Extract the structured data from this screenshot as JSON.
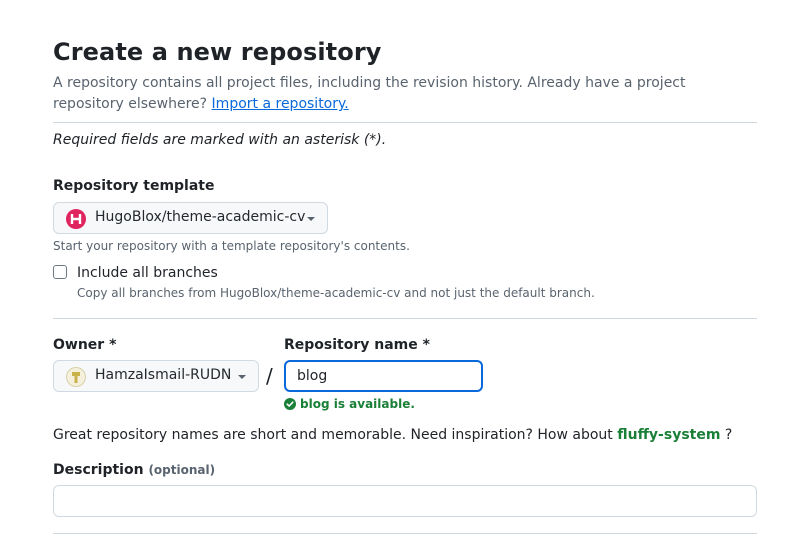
{
  "header": {
    "title": "Create a new repository",
    "description": "A repository contains all project files, including the revision history. Already have a project repository elsewhere?",
    "import_link": "Import a repository."
  },
  "required_note": "Required fields are marked with an asterisk (*).",
  "template": {
    "label": "Repository template",
    "selected": "HugoBlox/theme-academic-cv",
    "hint": "Start your repository with a template repository's contents."
  },
  "include_branches": {
    "label": "Include all branches",
    "hint": "Copy all branches from HugoBlox/theme-academic-cv and not just the default branch.",
    "checked": false
  },
  "owner": {
    "label": "Owner *",
    "selected": "HamzaIsmail-RUDN"
  },
  "separator": "/",
  "repo_name": {
    "label": "Repository name *",
    "value": "blog",
    "availability": "blog is available."
  },
  "suggestion": {
    "text": "Great repository names are short and memorable. Need inspiration? How about",
    "name": "fluffy-system",
    "suffix": "?"
  },
  "description_field": {
    "label": "Description",
    "optional": "(optional)",
    "value": ""
  },
  "colors": {
    "accent": "#0969da",
    "success": "#1a7f37",
    "template_icon": "#e0245e",
    "border": "#d1d9e0"
  }
}
